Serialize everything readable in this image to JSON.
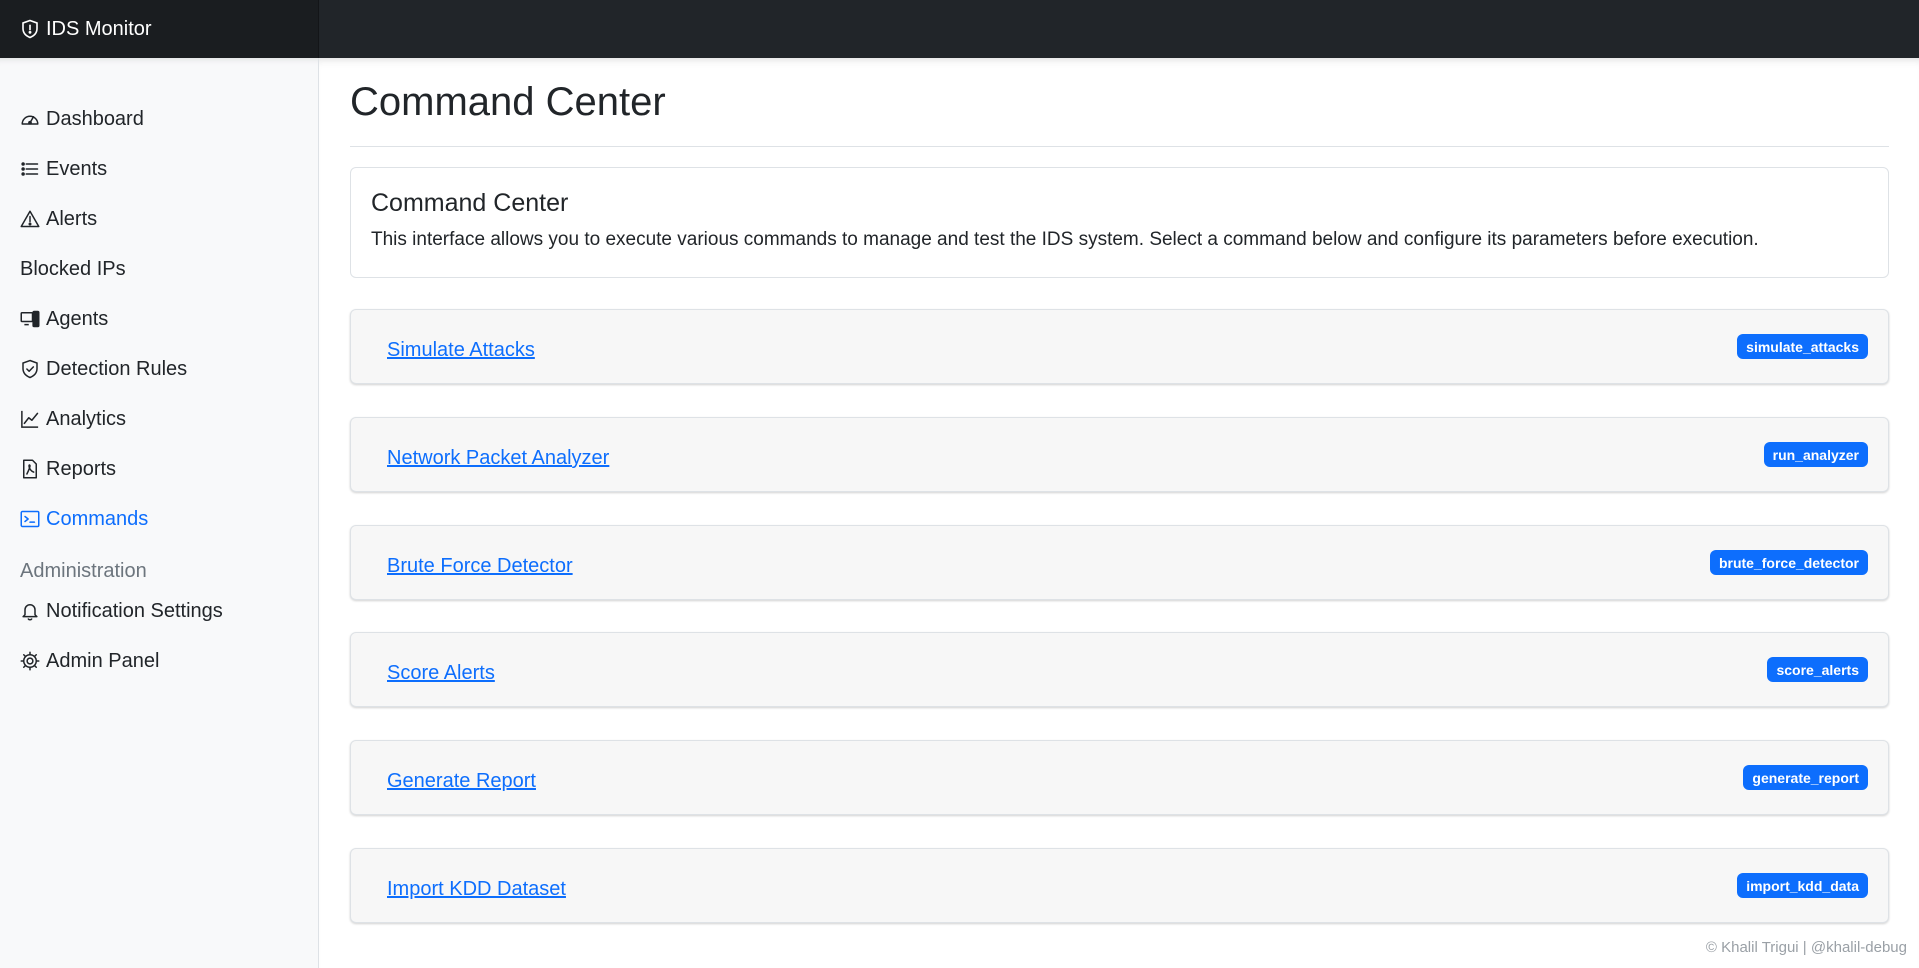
{
  "brand": {
    "name": "IDS Monitor"
  },
  "sidebar": {
    "items": [
      {
        "label": "Dashboard"
      },
      {
        "label": "Events"
      },
      {
        "label": "Alerts"
      },
      {
        "label": "Blocked IPs"
      },
      {
        "label": "Agents"
      },
      {
        "label": "Detection Rules"
      },
      {
        "label": "Analytics"
      },
      {
        "label": "Reports"
      },
      {
        "label": "Commands",
        "active": true
      }
    ],
    "admin_heading": "Administration",
    "admin_items": [
      {
        "label": "Notification Settings"
      },
      {
        "label": "Admin Panel"
      }
    ]
  },
  "main": {
    "title": "Command Center",
    "intro": {
      "title": "Command Center",
      "text": "This interface allows you to execute various commands to manage and test the IDS system. Select a command below and configure its parameters before execution."
    },
    "commands": [
      {
        "label": "Simulate Attacks",
        "badge": "simulate_attacks"
      },
      {
        "label": "Network Packet Analyzer",
        "badge": "run_analyzer"
      },
      {
        "label": "Brute Force Detector",
        "badge": "brute_force_detector"
      },
      {
        "label": "Score Alerts",
        "badge": "score_alerts"
      },
      {
        "label": "Generate Report",
        "badge": "generate_report"
      },
      {
        "label": "Import KDD Dataset",
        "badge": "import_kdd_data"
      }
    ]
  },
  "footer": {
    "text": "© Khalil Trigui | @khalil-debug"
  },
  "colors": {
    "accent": "#0d6efd",
    "topbar": "#212529",
    "sidebar_bg": "#f8f9fa",
    "muted": "#6c757d"
  }
}
